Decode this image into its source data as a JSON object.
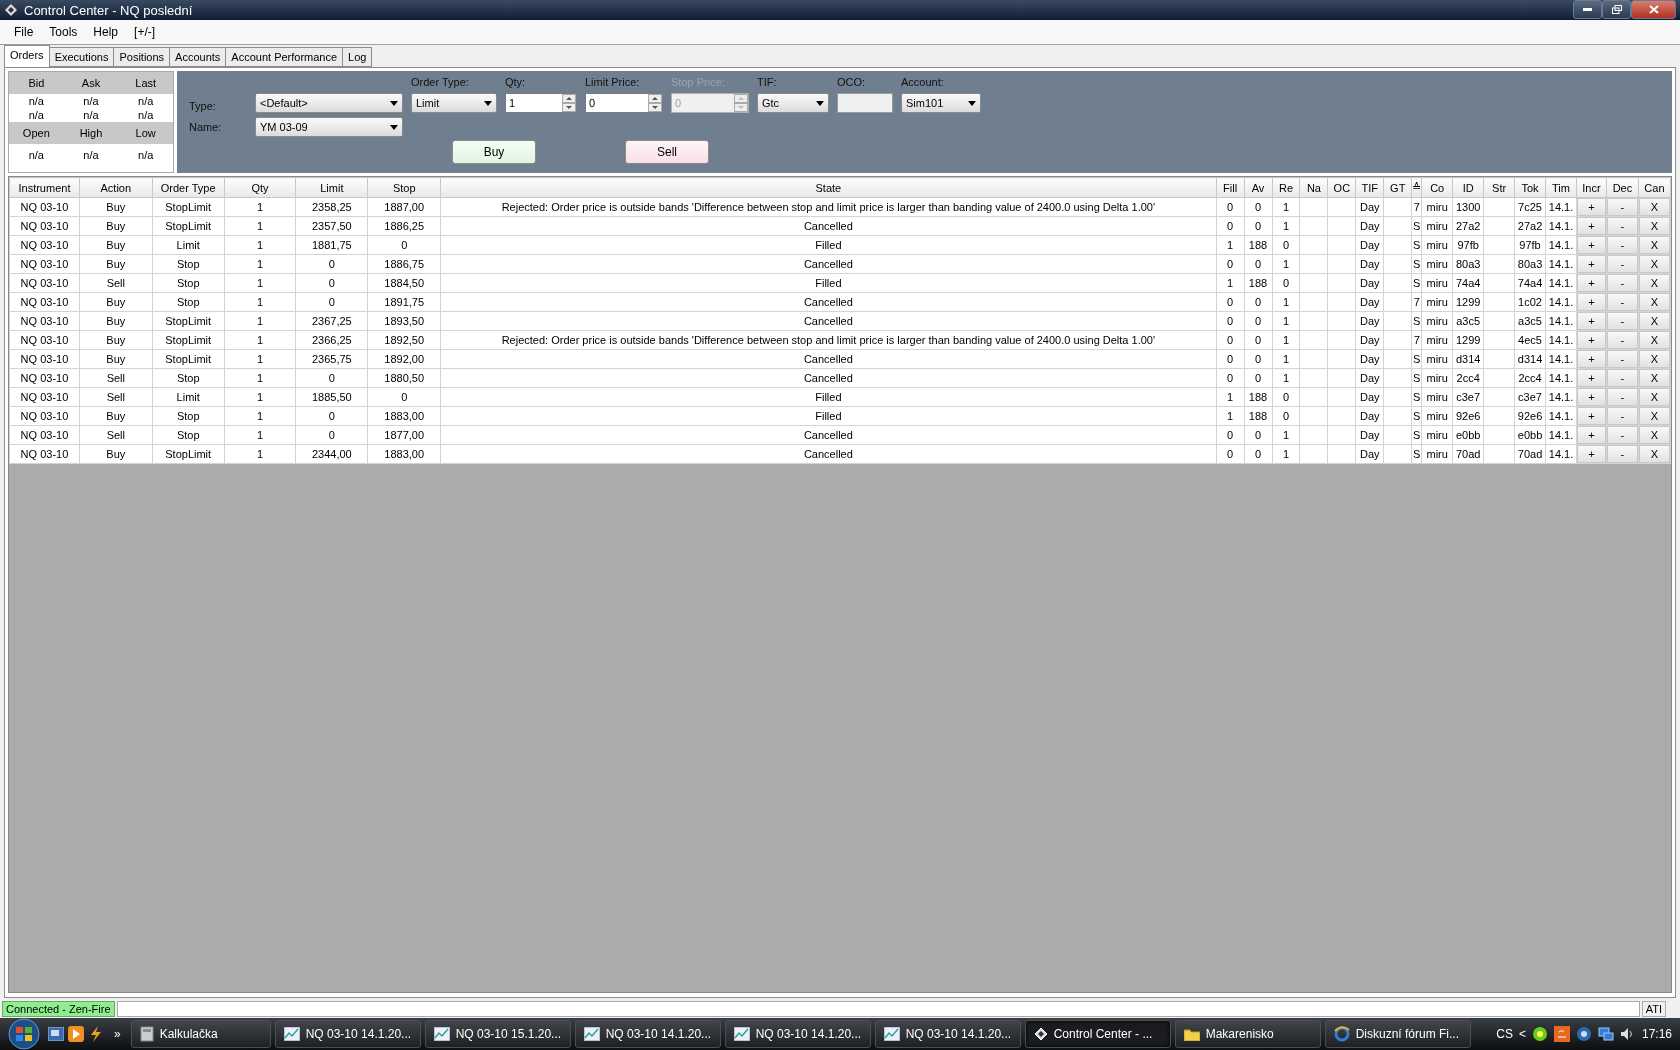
{
  "window": {
    "title": "Control Center - NQ poslední"
  },
  "menu": [
    "File",
    "Tools",
    "Help",
    "[+/-]"
  ],
  "tabs": [
    {
      "label": "Orders",
      "selected": true
    },
    {
      "label": "Executions",
      "selected": false
    },
    {
      "label": "Positions",
      "selected": false
    },
    {
      "label": "Accounts",
      "selected": false
    },
    {
      "label": "Account Performance",
      "selected": false
    },
    {
      "label": "Log",
      "selected": false
    }
  ],
  "quote": {
    "header1": [
      "Bid",
      "Ask",
      "Last"
    ],
    "rows1": [
      [
        "n/a",
        "n/a",
        "n/a"
      ],
      [
        "n/a",
        "n/a",
        "n/a"
      ]
    ],
    "header2": [
      "Open",
      "High",
      "Low"
    ],
    "rows2": [
      [
        "n/a",
        "n/a",
        "n/a"
      ]
    ]
  },
  "order_entry": {
    "type": {
      "label": "Type:",
      "value": "<Default>"
    },
    "name": {
      "label": "Name:",
      "value": "YM 03-09"
    },
    "fields": [
      {
        "kind": "dropdown",
        "label": "Order Type:",
        "value": "Limit",
        "disabled": false
      },
      {
        "kind": "spinner",
        "label": "Qty:",
        "value": "1",
        "disabled": false
      },
      {
        "kind": "spinner",
        "label": "Limit Price:",
        "value": "0",
        "disabled": false
      },
      {
        "kind": "spinner",
        "label": "Stop Price:",
        "value": "0",
        "disabled": true
      },
      {
        "kind": "dropdown",
        "label": "TIF:",
        "value": "Gtc",
        "disabled": false
      },
      {
        "kind": "text",
        "label": "OCO:",
        "disabled": false
      },
      {
        "kind": "dropdown",
        "label": "Account:",
        "value": "Sim101",
        "disabled": false
      }
    ],
    "buy": "Buy",
    "sell": "Sell"
  },
  "table": {
    "columns": [
      {
        "label": "Instrument",
        "kind": "text"
      },
      {
        "label": "Action",
        "kind": "text"
      },
      {
        "label": "Order Type",
        "kind": "text"
      },
      {
        "label": "Qty",
        "kind": "text"
      },
      {
        "label": "Limit",
        "kind": "text"
      },
      {
        "label": "Stop",
        "kind": "text"
      },
      {
        "label": "State",
        "kind": "text"
      },
      {
        "label": "Fill",
        "kind": "text"
      },
      {
        "label": "Av",
        "kind": "text"
      },
      {
        "label": "Re",
        "kind": "text"
      },
      {
        "label": "Na",
        "kind": "text"
      },
      {
        "label": "OC",
        "kind": "text"
      },
      {
        "label": "TIF",
        "kind": "text"
      },
      {
        "label": "GT",
        "kind": "text"
      },
      {
        "label": "≙",
        "kind": "text"
      },
      {
        "label": "Co",
        "kind": "text"
      },
      {
        "label": "ID",
        "kind": "text"
      },
      {
        "label": "Str",
        "kind": "text"
      },
      {
        "label": "Tok",
        "kind": "text"
      },
      {
        "label": "Tim",
        "kind": "text"
      },
      {
        "label": "Incr",
        "kind": "button"
      },
      {
        "label": "Dec",
        "kind": "button"
      },
      {
        "label": "Can",
        "kind": "button"
      }
    ],
    "rows": [
      [
        "NQ 03-10",
        "Buy",
        "StopLimit",
        "1",
        "2358,25",
        "1887,00",
        "Rejected: Order price is outside bands 'Difference between stop and limit price is larger than banding value of 2400.0 using Delta 1.00'",
        "0",
        "0",
        "1",
        "",
        "",
        "Day",
        "",
        "7",
        "miru",
        "1300",
        "",
        "7c25",
        "14.1.",
        "+",
        "-",
        "X"
      ],
      [
        "NQ 03-10",
        "Buy",
        "StopLimit",
        "1",
        "2357,50",
        "1886,25",
        "Cancelled",
        "0",
        "0",
        "1",
        "",
        "",
        "Day",
        "",
        "S",
        "miru",
        "27a2",
        "",
        "27a2",
        "14.1.",
        "+",
        "-",
        "X"
      ],
      [
        "NQ 03-10",
        "Buy",
        "Limit",
        "1",
        "1881,75",
        "0",
        "Filled",
        "1",
        "188",
        "0",
        "",
        "",
        "Day",
        "",
        "S",
        "miru",
        "97fb",
        "",
        "97fb",
        "14.1.",
        "+",
        "-",
        "X"
      ],
      [
        "NQ 03-10",
        "Buy",
        "Stop",
        "1",
        "0",
        "1886,75",
        "Cancelled",
        "0",
        "0",
        "1",
        "",
        "",
        "Day",
        "",
        "S",
        "miru",
        "80a3",
        "",
        "80a3",
        "14.1.",
        "+",
        "-",
        "X"
      ],
      [
        "NQ 03-10",
        "Sell",
        "Stop",
        "1",
        "0",
        "1884,50",
        "Filled",
        "1",
        "188",
        "0",
        "",
        "",
        "Day",
        "",
        "S",
        "miru",
        "74a4",
        "",
        "74a4",
        "14.1.",
        "+",
        "-",
        "X"
      ],
      [
        "NQ 03-10",
        "Buy",
        "Stop",
        "1",
        "0",
        "1891,75",
        "Cancelled",
        "0",
        "0",
        "1",
        "",
        "",
        "Day",
        "",
        "7",
        "miru",
        "1299",
        "",
        "1c02",
        "14.1.",
        "+",
        "-",
        "X"
      ],
      [
        "NQ 03-10",
        "Buy",
        "StopLimit",
        "1",
        "2367,25",
        "1893,50",
        "Cancelled",
        "0",
        "0",
        "1",
        "",
        "",
        "Day",
        "",
        "S",
        "miru",
        "a3c5",
        "",
        "a3c5",
        "14.1.",
        "+",
        "-",
        "X"
      ],
      [
        "NQ 03-10",
        "Buy",
        "StopLimit",
        "1",
        "2366,25",
        "1892,50",
        "Rejected: Order price is outside bands 'Difference between stop and limit price is larger than banding value of 2400.0 using Delta 1.00'",
        "0",
        "0",
        "1",
        "",
        "",
        "Day",
        "",
        "7",
        "miru",
        "1299",
        "",
        "4ec5",
        "14.1.",
        "+",
        "-",
        "X"
      ],
      [
        "NQ 03-10",
        "Buy",
        "StopLimit",
        "1",
        "2365,75",
        "1892,00",
        "Cancelled",
        "0",
        "0",
        "1",
        "",
        "",
        "Day",
        "",
        "S",
        "miru",
        "d314",
        "",
        "d314",
        "14.1.",
        "+",
        "-",
        "X"
      ],
      [
        "NQ 03-10",
        "Sell",
        "Stop",
        "1",
        "0",
        "1880,50",
        "Cancelled",
        "0",
        "0",
        "1",
        "",
        "",
        "Day",
        "",
        "S",
        "miru",
        "2cc4",
        "",
        "2cc4",
        "14.1.",
        "+",
        "-",
        "X"
      ],
      [
        "NQ 03-10",
        "Sell",
        "Limit",
        "1",
        "1885,50",
        "0",
        "Filled",
        "1",
        "188",
        "0",
        "",
        "",
        "Day",
        "",
        "S",
        "miru",
        "c3e7",
        "",
        "c3e7",
        "14.1.",
        "+",
        "-",
        "X"
      ],
      [
        "NQ 03-10",
        "Buy",
        "Stop",
        "1",
        "0",
        "1883,00",
        "Filled",
        "1",
        "188",
        "0",
        "",
        "",
        "Day",
        "",
        "S",
        "miru",
        "92e6",
        "",
        "92e6",
        "14.1.",
        "+",
        "-",
        "X"
      ],
      [
        "NQ 03-10",
        "Sell",
        "Stop",
        "1",
        "0",
        "1877,00",
        "Cancelled",
        "0",
        "0",
        "1",
        "",
        "",
        "Day",
        "",
        "S",
        "miru",
        "e0bb",
        "",
        "e0bb",
        "14.1.",
        "+",
        "-",
        "X"
      ],
      [
        "NQ 03-10",
        "Buy",
        "StopLimit",
        "1",
        "2344,00",
        "1883,00",
        "Cancelled",
        "0",
        "0",
        "1",
        "",
        "",
        "Day",
        "",
        "S",
        "miru",
        "70ad",
        "",
        "70ad",
        "14.1.",
        "+",
        "-",
        "X"
      ]
    ]
  },
  "status_bar": {
    "connection": "Connected - Zen-Fire",
    "right": "ATI"
  },
  "taskbar": {
    "overflow": "»",
    "tasks": [
      {
        "label": "Kalkulačka",
        "kind": "calculator",
        "selected": false
      },
      {
        "label": "NQ 03-10  14.1.20...",
        "kind": "chart",
        "selected": false
      },
      {
        "label": "NQ 03-10  15.1.20...",
        "kind": "chart",
        "selected": false
      },
      {
        "label": "NQ 03-10  14.1.20...",
        "kind": "chart",
        "selected": false
      },
      {
        "label": "NQ 03-10  14.1.20...",
        "kind": "chart",
        "selected": false
      },
      {
        "label": "NQ 03-10  14.1.20...",
        "kind": "chart",
        "selected": false
      },
      {
        "label": "Control Center - ...",
        "kind": "app",
        "selected": true
      },
      {
        "label": "Makarenisko",
        "kind": "folder",
        "selected": false
      },
      {
        "label": "Diskuzní fórum Fi...",
        "kind": "browser",
        "selected": false
      }
    ],
    "language": "CS",
    "tray_expand": "<",
    "clock": "17:16"
  }
}
